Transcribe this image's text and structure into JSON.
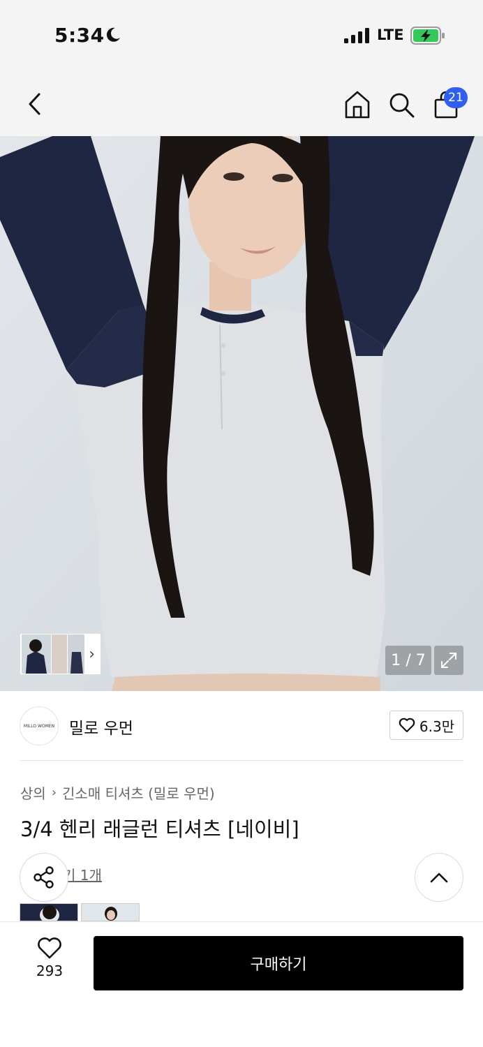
{
  "status_bar": {
    "time": "5:34",
    "network": "LTE",
    "icons": [
      "moon-icon",
      "signal-icon",
      "battery-charging-icon"
    ],
    "battery_color": "#34c759"
  },
  "nav": {
    "icons": [
      "back-icon",
      "home-icon",
      "search-icon",
      "shopping-bag-icon"
    ],
    "cart_count": "21",
    "badge_color": "#2f5ff0"
  },
  "gallery": {
    "page_indicator": "1 / 7",
    "current_page": 1,
    "total_pages": 7
  },
  "brand": {
    "logo_text": "MILLO WOMEN",
    "name": "밀로 우먼",
    "like_count": "6.3만"
  },
  "product": {
    "breadcrumb": [
      "상의",
      "긴소매 티셔츠 (밀로 우먼)"
    ],
    "title": "3/4 헨리 래글런 티셔츠 [네이비]",
    "review_link": "기 1개"
  },
  "bottom_bar": {
    "wish_count": "293",
    "buy_label": "구매하기"
  },
  "colors": {
    "accent": "#2f5ff0",
    "buy_button": "#000000"
  }
}
